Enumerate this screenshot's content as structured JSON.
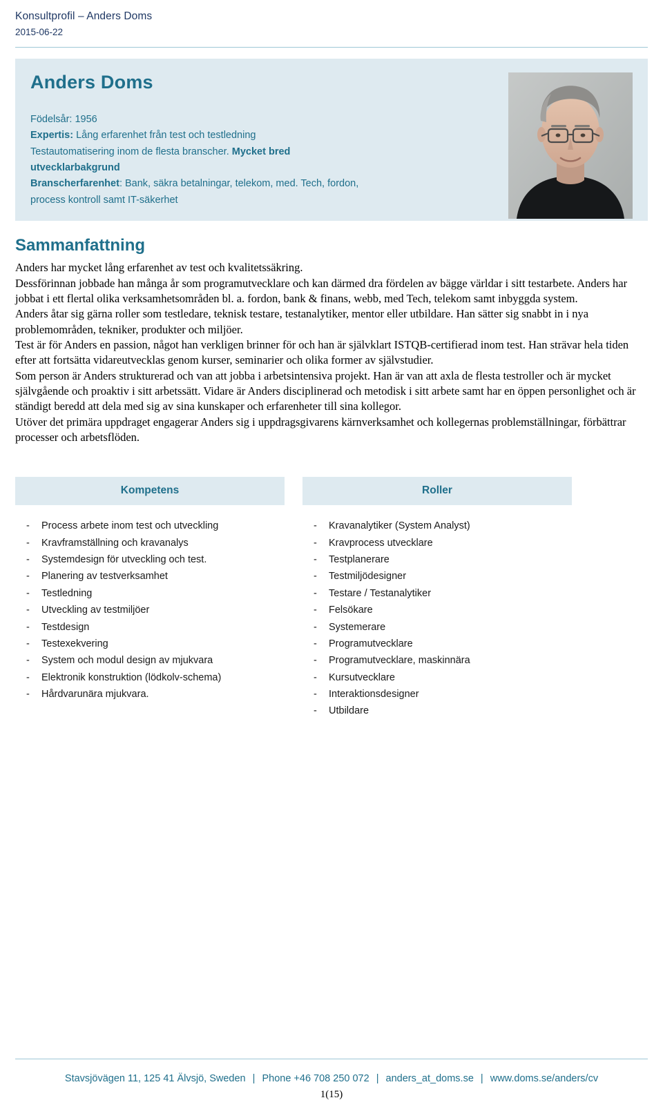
{
  "header": {
    "title": "Konsultprofil – Anders Doms",
    "date": "2015-06-22"
  },
  "profile": {
    "name": "Anders Doms",
    "birth_label": "Födelsår: 1956",
    "expertise_label": "Expertis:",
    "expertise_text": " Lång erfarenhet från test och testledning",
    "line3": "Testautomatisering inom de flesta branscher.",
    "line3_bold": " Mycket bred",
    "line4_bold": "utvecklarbakgrund",
    "industry_label": "Branscherfarenhet",
    "industry_text": ": Bank, säkra betalningar, telekom, med. Tech, fordon,",
    "line6": "process kontroll samt IT-säkerhet",
    "photo_alt": "portrait-photo"
  },
  "summary": {
    "heading": "Sammanfattning",
    "paragraphs": [
      "Anders har mycket lång erfarenhet av test och kvalitetssäkring.",
      "Dessförinnan jobbade han många år som programutvecklare och kan därmed dra fördelen av bägge världar i sitt testarbete. Anders har jobbat i ett flertal olika verksamhetsområden bl. a. fordon, bank & finans, webb, med Tech, telekom samt inbyggda system.",
      "Anders åtar sig gärna roller som testledare, teknisk testare, testanalytiker, mentor eller utbildare. Han sätter sig snabbt in i nya problemområden, tekniker, produkter och miljöer.",
      "Test är för Anders en passion, något han verkligen brinner för och han är självklart ISTQB-certifierad inom test. Han strävar hela tiden efter att fortsätta vidareutvecklas genom kurser, seminarier och olika former av självstudier.",
      "Som person är Anders strukturerad och van att jobba i arbetsintensiva projekt. Han är van att axla de flesta testroller och är mycket självgående och proaktiv i sitt arbetssätt. Vidare är Anders disciplinerad och metodisk i sitt arbete samt har en öppen personlighet och är ständigt beredd att dela med sig av sina kunskaper och erfarenheter till sina kollegor.",
      "Utöver det primära uppdraget engagerar Anders sig i uppdragsgivarens kärnverksamhet och kollegernas problemställningar, förbättrar processer och arbetsflöden."
    ]
  },
  "columns": {
    "kompetens": {
      "heading": "Kompetens",
      "items": [
        "Process arbete inom test och utveckling",
        "Kravframställning och kravanalys",
        "Systemdesign för utveckling och test.",
        "Planering av testverksamhet",
        "Testledning",
        "Utveckling av testmiljöer",
        "Testdesign",
        "Testexekvering",
        "System och modul design av mjukvara",
        "Elektronik konstruktion (lödkolv-schema)",
        "Hårdvarunära mjukvara."
      ]
    },
    "roller": {
      "heading": "Roller",
      "items": [
        "Kravanalytiker (System Analyst)",
        "Kravprocess utvecklare",
        "Testplanerare",
        "Testmiljödesigner",
        "Testare / Testanalytiker",
        "Felsökare",
        "Systemerare",
        "Programutvecklare",
        "Programutvecklare, maskinnära",
        "Kursutvecklare",
        "Interaktionsdesigner",
        "Utbildare"
      ]
    }
  },
  "footer": {
    "address": "Stavsjövägen 11, 125 41 Älvsjö, Sweden",
    "phone": "Phone +46 708 250 072",
    "email": "anders_at_doms.se",
    "website": "www.doms.se/anders/cv",
    "page_number": "1(15)",
    "separator": "|"
  },
  "colors": {
    "accent": "#1f6f8b",
    "band": "#deeaf0",
    "header_text": "#1f3864",
    "rule": "#9ec7d6"
  },
  "bullet_dash": "-"
}
